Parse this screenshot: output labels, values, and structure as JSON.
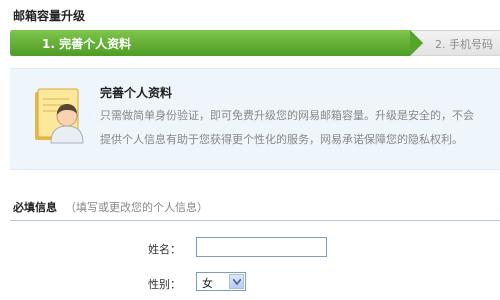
{
  "page": {
    "title": "邮箱容量升级"
  },
  "steps": {
    "active_label": "1. 完善个人资料",
    "next_label": "2. 手机号码"
  },
  "intro": {
    "icon": "profile-card-icon",
    "title": "完善个人资料",
    "line1": "只需做简单身份验证，即可免费升级您的网易邮箱容量。升级是安全的，不会",
    "line2": "提供个人信息有助于您获得更个性化的服务，网易承诺保障您的隐私权利。"
  },
  "form": {
    "section_title": "必填信息",
    "section_hint": "（填写或更改您的个人信息）",
    "name_label": "姓名：",
    "name_value": "",
    "gender_label": "性别：",
    "gender_value": "女"
  },
  "colors": {
    "active_step": "#5fae33",
    "panel_background": "#eef5fb",
    "divider": "#b9c8d6"
  }
}
